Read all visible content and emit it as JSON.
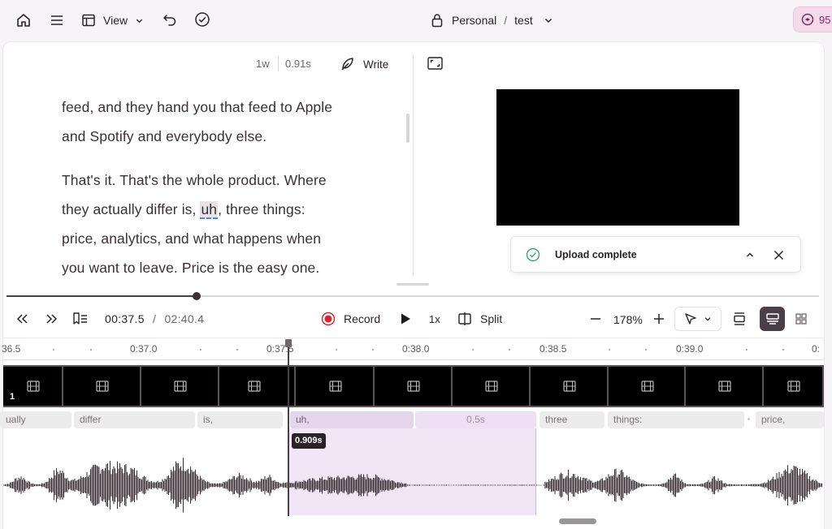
{
  "topbar": {
    "view_label": "View",
    "workspace": "Personal",
    "separator": "/",
    "project": "test",
    "credits": "95"
  },
  "editor": {
    "word_count": "1w",
    "duration": "0.91s",
    "write_label": "Write",
    "paragraph1": [
      "feed, and they hand you that feed to Apple",
      "and Spotify and everybody else."
    ],
    "paragraph2_line1": "That's it. That's the whole product. Where",
    "paragraph2_line2_before": "they actually differ is, ",
    "paragraph2_line2_highlight": "uh",
    "paragraph2_line2_after": ", three things:",
    "paragraph2_line3": "price, analytics, and what happens when",
    "paragraph2_line4": "you want to leave. Price is the easy one."
  },
  "toast": {
    "message": "Upload complete",
    "icon": "check-circle-icon"
  },
  "controls": {
    "current_time": "00:37",
    "current_frac": ".5",
    "slash": "/",
    "total_time": "02:40",
    "total_frac": ".4",
    "record_label": "Record",
    "speed_label": "1x",
    "split_label": "Split",
    "zoom_label": "178%",
    "playback_progress": 0.234,
    "record_color": "#e0202e"
  },
  "timeline": {
    "ruler_labels": [
      "36.5",
      "0:37.0",
      "0:37.5",
      "0:38.0",
      "0:38.5",
      "0:39.0",
      "0:"
    ],
    "track_number": "1",
    "selection_duration": "0.909s",
    "gap_label": "0.5s",
    "words": [
      "ually",
      "differ",
      "is,",
      "uh,",
      "three",
      "things:",
      "price,"
    ],
    "selection_color": "#f1e6f6"
  }
}
